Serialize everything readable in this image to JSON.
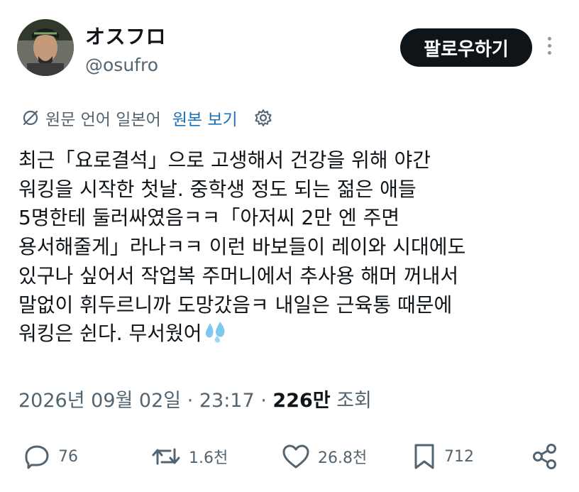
{
  "author": {
    "display_name": "オスフロ",
    "handle": "@osufro",
    "avatar_icon": "avatar-photo"
  },
  "follow_button": {
    "label": "팔로우하기"
  },
  "more_icon": "more-vertical-icon",
  "translation": {
    "icon": "translate-globe-icon",
    "source_text": "원문 언어 일본어",
    "show_original_label": "원본 보기",
    "settings_icon": "gear-icon"
  },
  "tweet": {
    "lines": [
      "최근「요로결석」으로 고생해서 건강을 위해 야간",
      "워킹을 시작한 첫날. 중학생 정도 되는 젊은 애들",
      "5명한테 둘러싸였음ㅋㅋ「아저씨 2만 엔 주면",
      "용서해줄게」라나ㅋㅋ 이런 바보들이 레이와 시대에도",
      "있구나 싶어서 작업복 주머니에서 추사용 해머 꺼내서",
      "말없이 휘두르니까 도망갔음ㅋ 내일은 근육통 때문에",
      "워킹은 쉰다. 무서웠어"
    ],
    "emoji": "sweat-droplets-emoji"
  },
  "meta": {
    "date": "2026년 09월 02일 · 23:17 · ",
    "views_count": "226만",
    "views_label": " 조회"
  },
  "actions": {
    "replies": {
      "icon": "reply-icon",
      "count": "76"
    },
    "reposts": {
      "icon": "repost-icon",
      "count": "1.6천"
    },
    "likes": {
      "icon": "heart-icon",
      "count": "26.8천"
    },
    "bookmarks": {
      "icon": "bookmark-icon",
      "count": "712"
    },
    "share": {
      "icon": "share-icon"
    }
  },
  "colors": {
    "text": "#0f1419",
    "secondary": "#536471",
    "link": "#1d6fb8",
    "button_bg": "#0f1419",
    "emoji_blue": "#7ec8f0"
  }
}
